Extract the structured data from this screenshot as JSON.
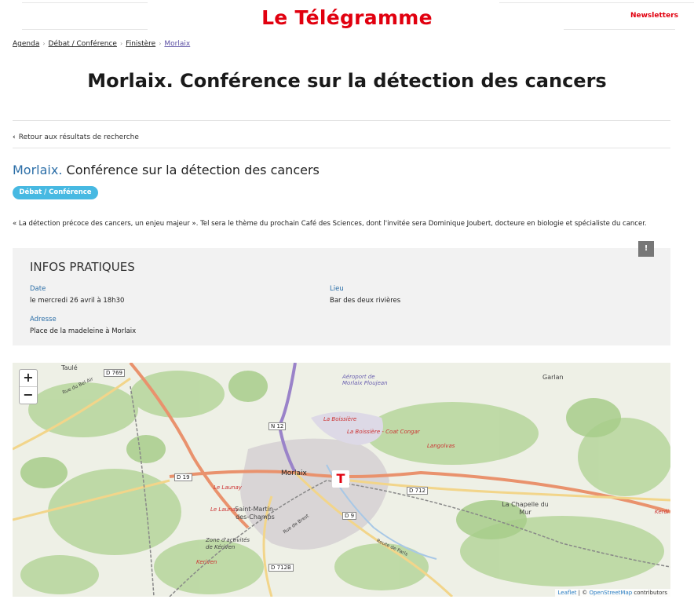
{
  "header": {
    "logo": "Le Télégramme",
    "newsletters": "Newsletters"
  },
  "breadcrumb": [
    {
      "label": "Agenda"
    },
    {
      "label": "Débat / Conférence"
    },
    {
      "label": "Finistère"
    },
    {
      "label": "Morlaix"
    }
  ],
  "page_title": "Morlaix. Conférence sur la détection des cancers",
  "back_link": "Retour aux résultats de recherche",
  "event": {
    "city": "Morlaix.",
    "title": "Conférence sur la détection des cancers",
    "category": "Débat / Conférence",
    "intro": "« La détection précoce des cancers, un enjeu majeur ». Tel sera le thème du prochain Café des Sciences, dont l'invitée sera Dominique Joubert, docteure en biologie et spécialiste du cancer."
  },
  "infos": {
    "title_light": "INFOS",
    "title_bold": "PRATIQUES",
    "date_label": "Date",
    "date_value": "le mercredi 26 avril à 18h30",
    "lieu_label": "Lieu",
    "lieu_value": "Bar des deux rivières",
    "adresse_label": "Adresse",
    "adresse_value": "Place de la madeleine à Morlaix",
    "alert": "!"
  },
  "map": {
    "zoom_in": "+",
    "zoom_out": "−",
    "marker": "T",
    "attribution_leaflet": "Leaflet",
    "attribution_osm": "OpenStreetMap",
    "attribution_suffix": "contributors",
    "attribution_sep": "| ©",
    "labels": {
      "taule": "Taulé",
      "garlan": "Garlan",
      "morlaix": "Morlaix",
      "la_boissiere": "La Boissière",
      "la_boissiere_coat": "La Boissière - Coat Congar",
      "langolvas": "Langolvas",
      "aeroport": "Aéroport de Morlaix Ploujean",
      "le_launay": "Le Launay",
      "le_launay2": "Le Launay",
      "saint_martin": "Saint-Martin-des-Champs",
      "la_chapelle": "La Chapelle du Mur",
      "zone": "Zone d'activités de Kériven",
      "keriven": "Keriven",
      "kerdi": "Kerdi",
      "rue_bel_air": "Rue du Bel Air",
      "route_brest": "Rue de Brest",
      "route_paris": "Route de Paris"
    },
    "roads": {
      "d769": "D 769",
      "n12": "N 12",
      "d19": "D 19",
      "d712": "D 712",
      "d9": "D 9",
      "d712b": "D 712B"
    }
  }
}
